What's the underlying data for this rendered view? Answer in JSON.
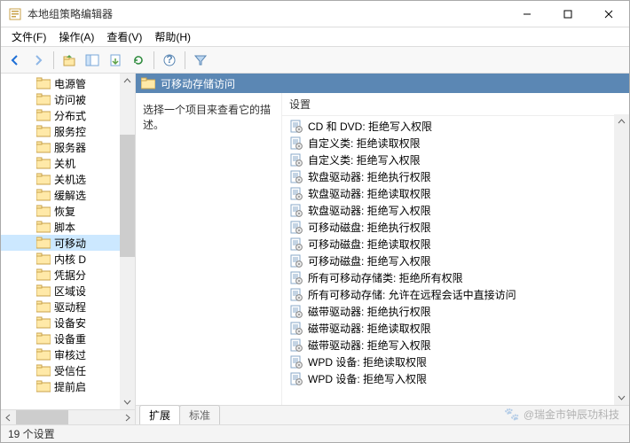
{
  "window": {
    "title": "本地组策略编辑器"
  },
  "menu": {
    "file": "文件(F)",
    "action": "操作(A)",
    "view": "查看(V)",
    "help": "帮助(H)"
  },
  "tree": {
    "items": [
      {
        "label": "电源管",
        "selected": false
      },
      {
        "label": "访问被",
        "selected": false
      },
      {
        "label": "分布式",
        "selected": false
      },
      {
        "label": "服务控",
        "selected": false
      },
      {
        "label": "服务器",
        "selected": false
      },
      {
        "label": "关机",
        "selected": false
      },
      {
        "label": "关机选",
        "selected": false
      },
      {
        "label": "缓解选",
        "selected": false
      },
      {
        "label": "恢复",
        "selected": false
      },
      {
        "label": "脚本",
        "selected": false
      },
      {
        "label": "可移动",
        "selected": true
      },
      {
        "label": "内核 D",
        "selected": false
      },
      {
        "label": "凭据分",
        "selected": false
      },
      {
        "label": "区域设",
        "selected": false
      },
      {
        "label": "驱动程",
        "selected": false
      },
      {
        "label": "设备安",
        "selected": false
      },
      {
        "label": "设备重",
        "selected": false
      },
      {
        "label": "审核过",
        "selected": false
      },
      {
        "label": "受信任",
        "selected": false
      },
      {
        "label": "提前启",
        "selected": false
      }
    ]
  },
  "right": {
    "header_title": "可移动存储访问",
    "description": "选择一个项目来查看它的描述。",
    "column_header": "设置",
    "settings": [
      "CD 和 DVD: 拒绝写入权限",
      "自定义类: 拒绝读取权限",
      "自定义类: 拒绝写入权限",
      "软盘驱动器: 拒绝执行权限",
      "软盘驱动器: 拒绝读取权限",
      "软盘驱动器: 拒绝写入权限",
      "可移动磁盘: 拒绝执行权限",
      "可移动磁盘: 拒绝读取权限",
      "可移动磁盘: 拒绝写入权限",
      "所有可移动存储类: 拒绝所有权限",
      "所有可移动存储: 允许在远程会话中直接访问",
      "磁带驱动器: 拒绝执行权限",
      "磁带驱动器: 拒绝读取权限",
      "磁带驱动器: 拒绝写入权限",
      "WPD 设备: 拒绝读取权限",
      "WPD 设备: 拒绝写入权限"
    ]
  },
  "tabs": {
    "extended": "扩展",
    "standard": "标准"
  },
  "status": {
    "text": "19 个设置"
  },
  "watermark": {
    "text": "@瑞金市钟辰功科技"
  }
}
